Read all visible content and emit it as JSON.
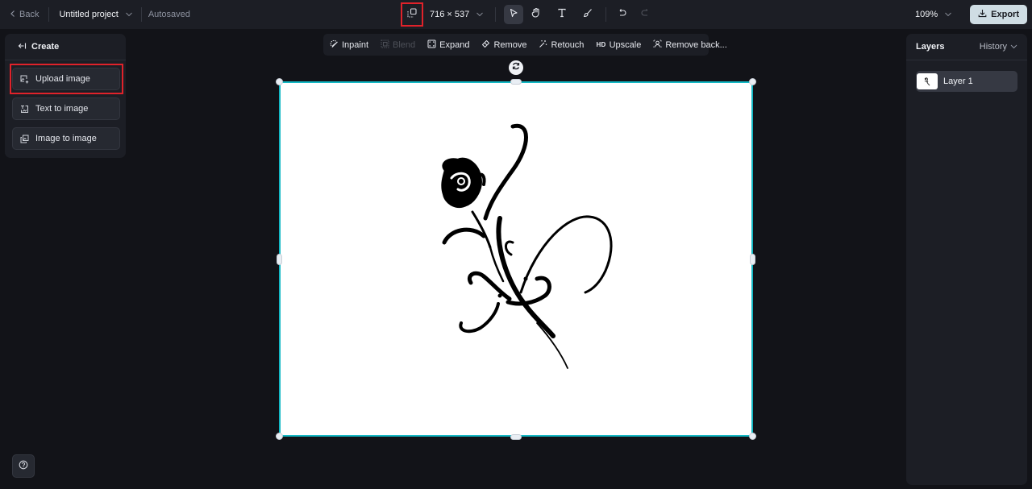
{
  "topbar": {
    "back_label": "Back",
    "project_title": "Untitled project",
    "autosave_status": "Autosaved",
    "canvas_width": "716",
    "dims_separator": "×",
    "canvas_height": "537",
    "zoom_level": "109%",
    "export_label": "Export",
    "tools": [
      {
        "name": "select",
        "icon": "cursor-icon",
        "active": true
      },
      {
        "name": "hand",
        "icon": "hand-icon",
        "active": false
      },
      {
        "name": "text",
        "icon": "text-icon",
        "active": false
      },
      {
        "name": "brush",
        "icon": "brush-icon",
        "active": false
      }
    ],
    "undo_enabled": true,
    "redo_enabled": false
  },
  "left_panel": {
    "header": "Create",
    "items": [
      {
        "label": "Upload image",
        "icon": "upload-image-icon",
        "highlighted": true
      },
      {
        "label": "Text to image",
        "icon": "text-to-image-icon"
      },
      {
        "label": "Image to image",
        "icon": "image-to-image-icon"
      }
    ]
  },
  "edit_toolbar": {
    "items": [
      {
        "label": "Inpaint",
        "icon": "inpaint-icon",
        "enabled": true
      },
      {
        "label": "Blend",
        "icon": "blend-icon",
        "enabled": false
      },
      {
        "label": "Expand",
        "icon": "expand-icon",
        "enabled": true
      },
      {
        "label": "Remove",
        "icon": "eraser-icon",
        "enabled": true
      },
      {
        "label": "Retouch",
        "icon": "magic-wand-icon",
        "enabled": true
      },
      {
        "label": "Upscale",
        "icon": "hd-icon",
        "icon_text": "HD",
        "enabled": true
      },
      {
        "label": "Remove back...",
        "icon": "remove-background-icon",
        "enabled": true
      }
    ]
  },
  "right_panel": {
    "title": "Layers",
    "history_label": "History",
    "layers": [
      {
        "name": "Layer 1",
        "selected": true
      }
    ]
  },
  "canvas": {
    "content": "Black tribal rose line-art on white background",
    "selection_color": "#14b8c4"
  },
  "colors": {
    "accent": "#14b8c4",
    "highlight_red": "#e0222a",
    "export_bg": "#cfdde4"
  }
}
